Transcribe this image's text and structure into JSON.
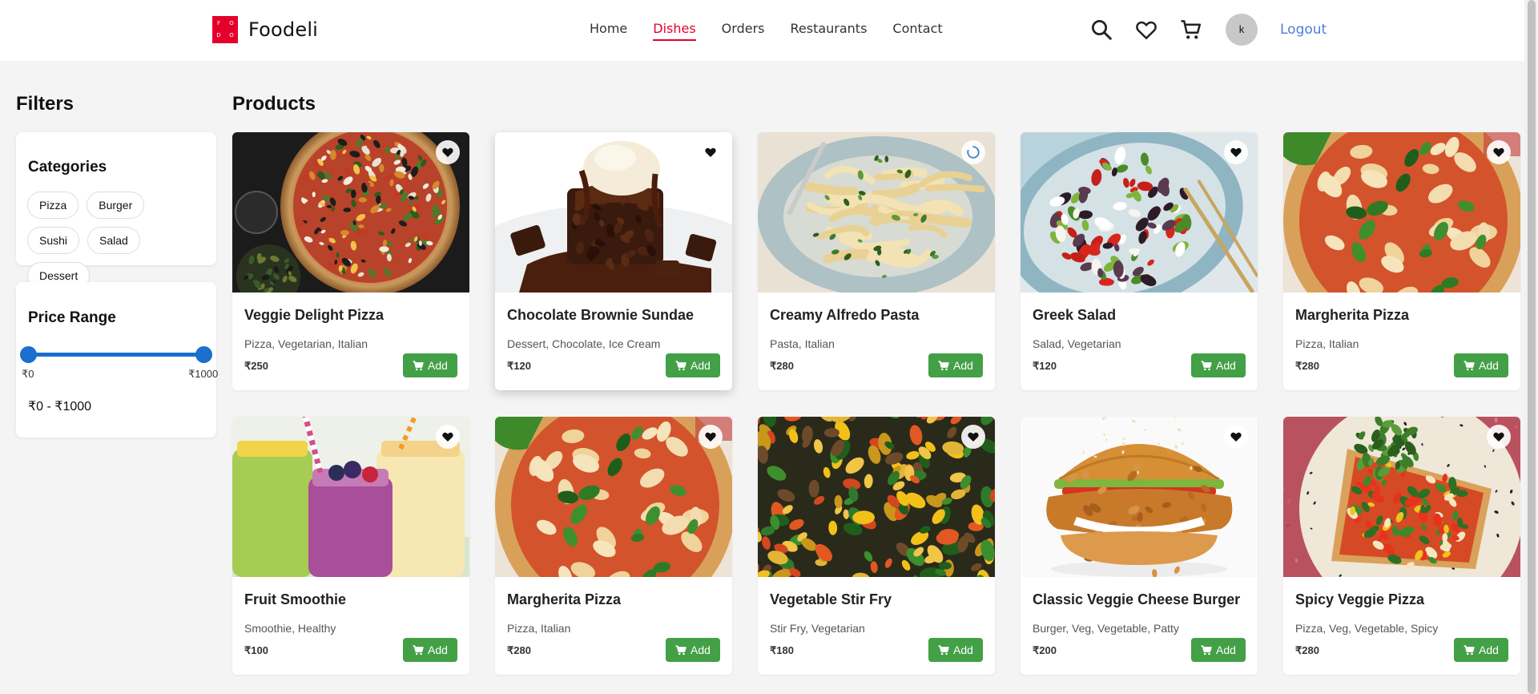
{
  "brand": {
    "name": "Foodeli",
    "mark_letters": [
      "F",
      "O",
      "D",
      "O"
    ],
    "color": "#e4002b"
  },
  "nav": [
    {
      "label": "Home",
      "active": false
    },
    {
      "label": "Dishes",
      "active": true
    },
    {
      "label": "Orders",
      "active": false
    },
    {
      "label": "Restaurants",
      "active": false
    },
    {
      "label": "Contact",
      "active": false
    }
  ],
  "header_icons": [
    "search-icon",
    "heart-icon",
    "cart-icon"
  ],
  "user": {
    "avatar_initial": "k",
    "logout_label": "Logout"
  },
  "filters": {
    "title": "Filters",
    "categories": {
      "title": "Categories",
      "items": [
        "Pizza",
        "Burger",
        "Sushi",
        "Salad",
        "Dessert"
      ]
    },
    "price": {
      "title": "Price Range",
      "min_label": "₹0",
      "max_label": "₹1000",
      "range_text": "₹0 - ₹1000"
    }
  },
  "products": {
    "title": "Products",
    "add_label": "Add",
    "accent_add": "#43a047",
    "items": [
      {
        "name": "Veggie Delight Pizza",
        "tags": "Pizza, Vegetarian, Italian",
        "price": "₹250",
        "image": "pizza"
      },
      {
        "name": "Chocolate Brownie Sundae",
        "tags": "Dessert, Chocolate, Ice Cream",
        "price": "₹120",
        "image": "brownie"
      },
      {
        "name": "Creamy Alfredo Pasta",
        "tags": "Pasta, Italian",
        "price": "₹280",
        "image": "pasta"
      },
      {
        "name": "Greek Salad",
        "tags": "Salad, Vegetarian",
        "price": "₹120",
        "image": "salad"
      },
      {
        "name": "Margherita Pizza",
        "tags": "Pizza, Italian",
        "price": "₹280",
        "image": "margherita"
      },
      {
        "name": "Fruit Smoothie",
        "tags": "Smoothie, Healthy",
        "price": "₹100",
        "image": "smoothie"
      },
      {
        "name": "Margherita Pizza",
        "tags": "Pizza, Italian",
        "price": "₹280",
        "image": "margherita"
      },
      {
        "name": "Vegetable Stir Fry",
        "tags": "Stir Fry, Vegetarian",
        "price": "₹180",
        "image": "stirfry"
      },
      {
        "name": "Classic Veggie Cheese Burger",
        "tags": "Burger, Veg, Vegetable, Patty",
        "price": "₹200",
        "image": "burger"
      },
      {
        "name": "Spicy Veggie Pizza",
        "tags": "Pizza, Veg, Vegetable, Spicy",
        "price": "₹280",
        "image": "spicy"
      }
    ]
  }
}
